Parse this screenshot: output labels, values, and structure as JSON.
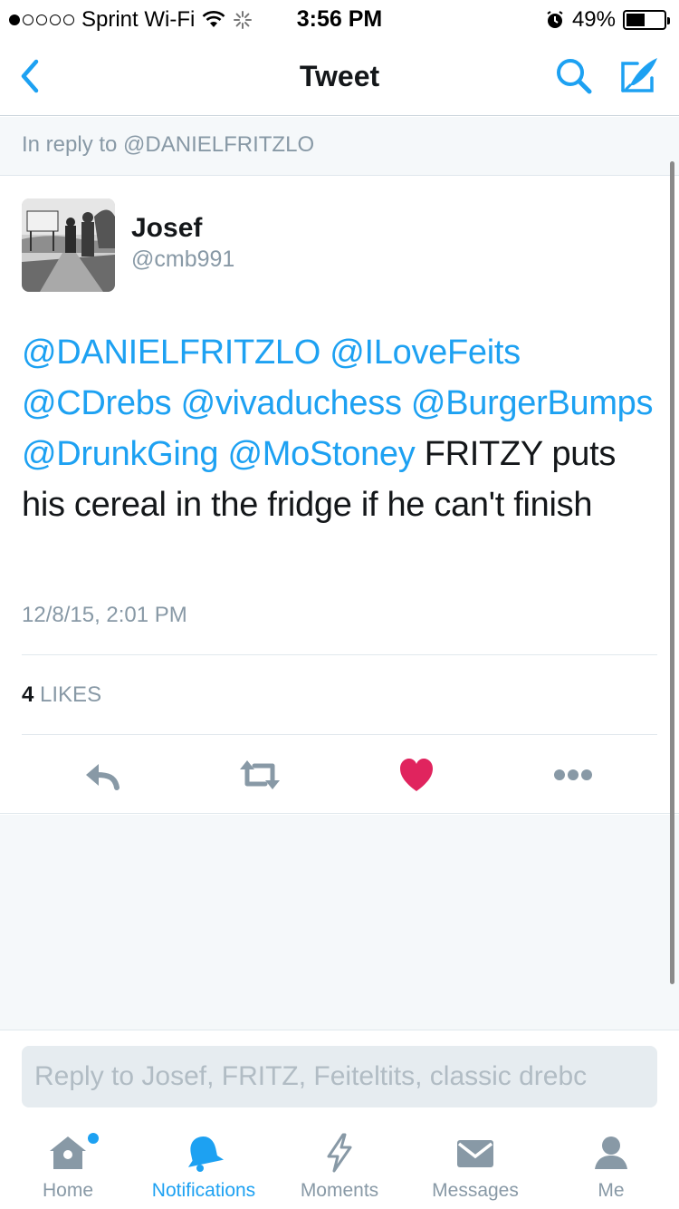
{
  "status_bar": {
    "carrier": "Sprint Wi-Fi",
    "time": "3:56 PM",
    "battery_percent": "49%",
    "battery_level": 0.49,
    "signal_bars": 1
  },
  "nav": {
    "title": "Tweet"
  },
  "reply_context": "In reply to @DANIELFRITZLO",
  "tweet": {
    "author_name": "Josef",
    "author_handle": "@cmb991",
    "text": {
      "mentions": [
        "@DANIELFRITZLO",
        "@ILoveFeits",
        "@CDrebs",
        "@vivaduchess",
        "@BurgerBumps",
        "@DrunkGing",
        "@MoStoney"
      ],
      "body": "FRITZY puts his cereal in the fridge if he can't finish"
    },
    "timestamp": "12/8/15, 2:01 PM",
    "likes_count": "4",
    "likes_label": "LIKES",
    "liked": true
  },
  "reply_bar": {
    "placeholder": "Reply to Josef, FRITZ, Feiteltits, classic drebc"
  },
  "tabs": [
    {
      "label": "Home",
      "icon": "home-icon",
      "active": false,
      "has_badge": true
    },
    {
      "label": "Notifications",
      "icon": "bell-icon",
      "active": true,
      "has_badge": false
    },
    {
      "label": "Moments",
      "icon": "lightning-icon",
      "active": false,
      "has_badge": false
    },
    {
      "label": "Messages",
      "icon": "envelope-icon",
      "active": false,
      "has_badge": false
    },
    {
      "label": "Me",
      "icon": "person-icon",
      "active": false,
      "has_badge": false
    }
  ],
  "colors": {
    "accent": "#1da1f2",
    "like": "#e0245e",
    "muted": "#8899a6",
    "text": "#14171a",
    "background_alt": "#f5f8fa"
  }
}
